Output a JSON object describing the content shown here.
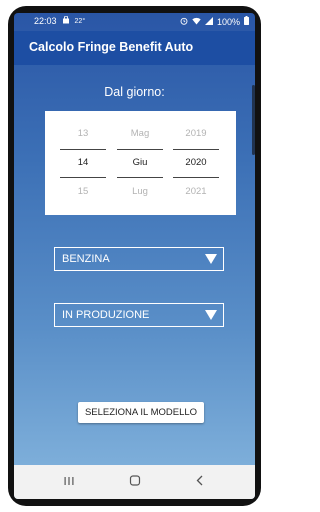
{
  "status_bar": {
    "time": "22:03",
    "temperature": "22°",
    "battery": "100%",
    "icons": [
      "bag-icon",
      "alarm-icon",
      "wifi-icon",
      "signal-icon",
      "battery-icon"
    ]
  },
  "app_bar": {
    "title": "Calcolo Fringe Benefit Auto"
  },
  "date_section": {
    "label": "Dal giorno:"
  },
  "date_picker": {
    "day": {
      "prev": "13",
      "selected": "14",
      "next": "15"
    },
    "month": {
      "prev": "Mag",
      "selected": "Giu",
      "next": "Lug"
    },
    "year": {
      "prev": "2019",
      "selected": "2020",
      "next": "2021"
    }
  },
  "fuel_select": {
    "value": "BENZINA"
  },
  "status_select": {
    "value": "IN PRODUZIONE"
  },
  "select_model_button": {
    "label": "SELEZIONA IL MODELLO"
  },
  "nav_bar": {
    "icons": [
      "recents-icon",
      "home-icon",
      "back-icon"
    ]
  },
  "colors": {
    "app_bar": "#1d4ea3",
    "gradient_top": "#2a56a6",
    "gradient_bottom": "#86b6de",
    "nav_bar": "#f2f2f2"
  }
}
